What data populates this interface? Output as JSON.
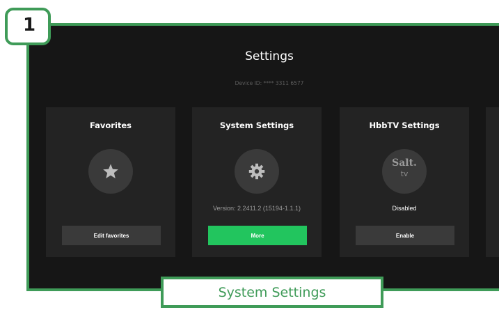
{
  "step": {
    "number": "1"
  },
  "screen": {
    "title": "Settings",
    "device_id": "Device ID: **** 3311 6577"
  },
  "cards": [
    {
      "title": "Favorites",
      "icon": "star-icon",
      "status": "",
      "button": "Edit favorites",
      "button_style": "secondary"
    },
    {
      "title": "System Settings",
      "icon": "gear-icon",
      "status": "Version: 2.2411.2 (15194-1.1.1)",
      "button": "More",
      "button_style": "primary"
    },
    {
      "title": "HbbTV Settings",
      "icon": "salt-tv-logo",
      "logo_text": "Salt.",
      "logo_sub": "tv",
      "status": "Disabled",
      "button": "Enable",
      "button_style": "secondary"
    }
  ],
  "caption": {
    "label": "System Settings"
  },
  "colors": {
    "accent_green": "#3f9b58",
    "button_green": "#22c55e",
    "screen_bg": "#161616",
    "card_bg": "#232323"
  }
}
